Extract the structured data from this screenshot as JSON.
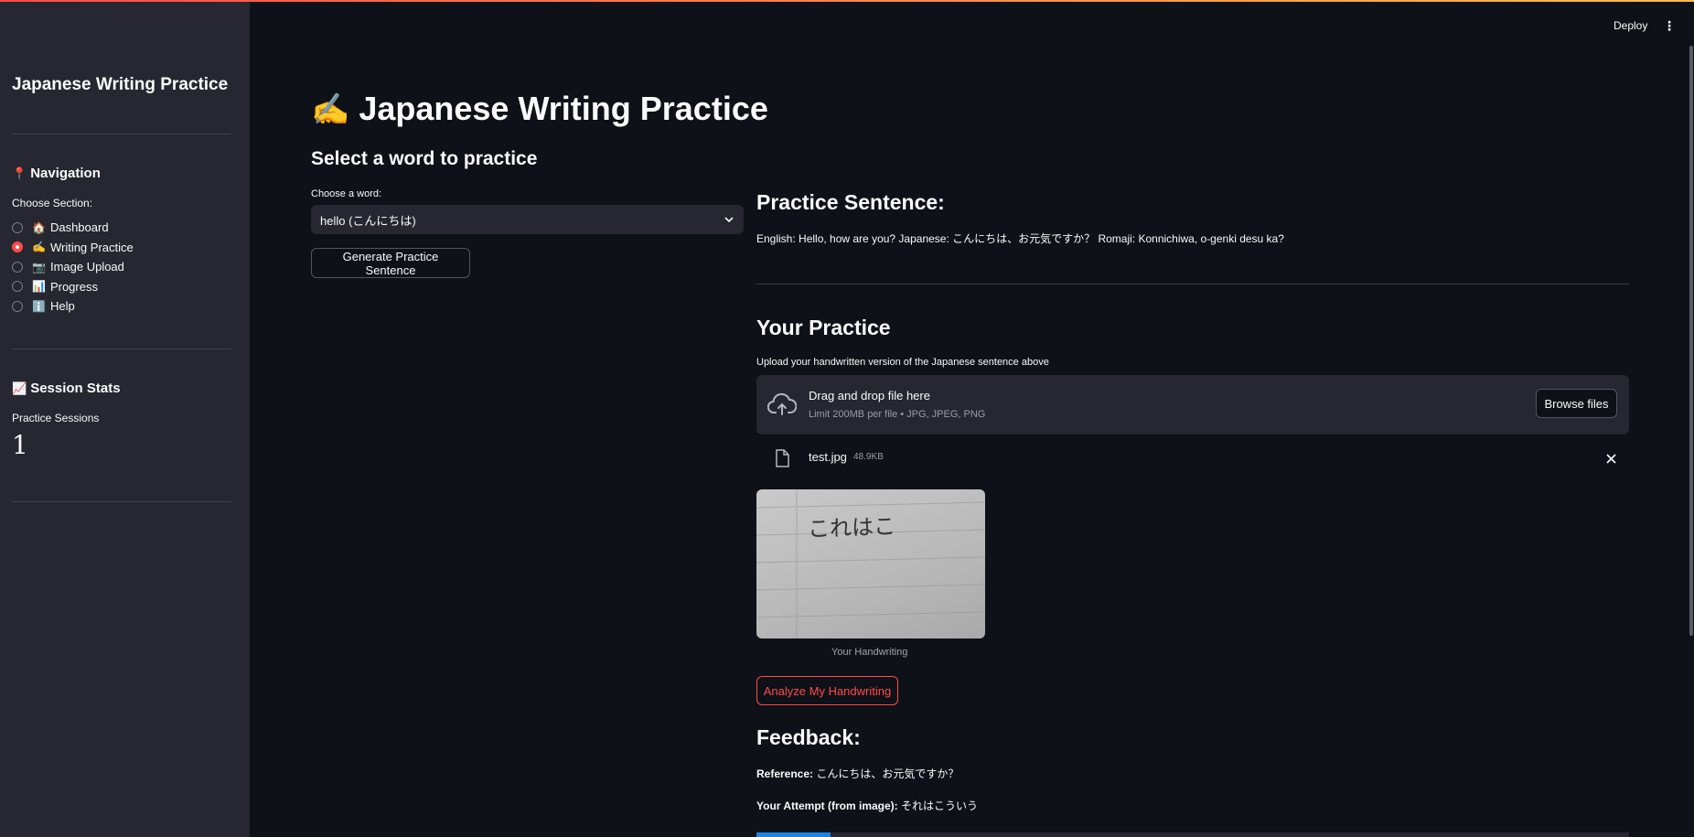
{
  "sidebar": {
    "title": "Japanese Writing Practice",
    "navigation": {
      "emoji": "📍",
      "heading": "Navigation"
    },
    "choose_section_label": "Choose Section:",
    "items": [
      {
        "emoji": "🏠",
        "label": "Dashboard",
        "selected": false
      },
      {
        "emoji": "✍️",
        "label": "Writing Practice",
        "selected": true
      },
      {
        "emoji": "📷",
        "label": "Image Upload",
        "selected": false
      },
      {
        "emoji": "📊",
        "label": "Progress",
        "selected": false
      },
      {
        "emoji": "ℹ️",
        "label": "Help",
        "selected": false
      }
    ],
    "stats": {
      "emoji": "📈",
      "heading": "Session Stats",
      "label": "Practice Sessions",
      "value": "1"
    }
  },
  "header": {
    "deploy_label": "Deploy",
    "menu_icon": "⋮"
  },
  "main": {
    "title_emoji": "✍️",
    "title": "Japanese Writing Practice",
    "select_heading": "Select a word to practice",
    "choose_word_label": "Choose a word:",
    "selected_word": "hello (こんにちは)",
    "generate_button": "Generate Practice Sentence",
    "practice_sentence_heading": "Practice Sentence:",
    "practice_sentence_text": "English: Hello, how are you? Japanese: こんにちは、お元気ですか？ Romaji: Konnichiwa, o-genki desu ka?",
    "your_practice_heading": "Your Practice",
    "upload_instruction": "Upload your handwritten version of the Japanese sentence above",
    "uploader": {
      "drag_text": "Drag and drop file here",
      "limit_text": "Limit 200MB per file • JPG, JPEG, PNG",
      "browse_label": "Browse files"
    },
    "file": {
      "name": "test.jpg",
      "size": "48.9KB"
    },
    "handwriting_text": "これはこ",
    "image_caption": "Your Handwriting",
    "analyze_button": "Analyze My Handwriting",
    "feedback_heading": "Feedback:",
    "reference_label": "Reference:",
    "reference_text": "こんにちは、お元気ですか？",
    "attempt_label": "Your Attempt (from image):",
    "attempt_text": "それはこういう",
    "progress_fraction": 0.085
  },
  "colors": {
    "accent": "#ff4b4b",
    "progress": "#1c83e1",
    "background": "#0e1117",
    "sidebar": "#262730"
  }
}
